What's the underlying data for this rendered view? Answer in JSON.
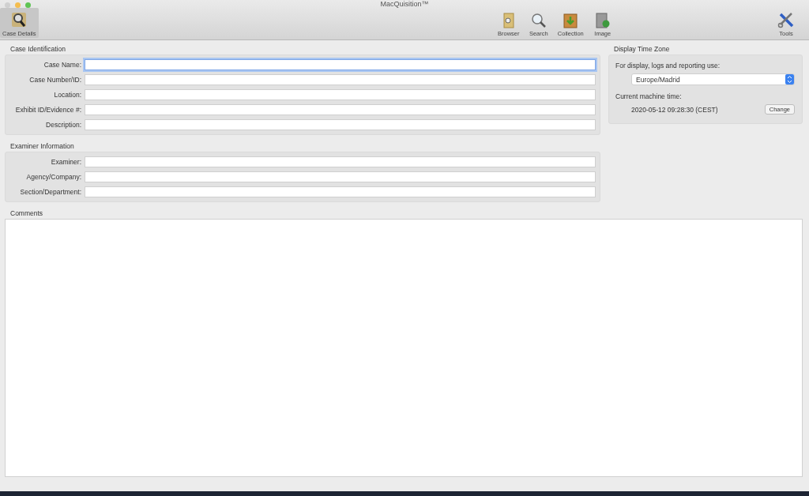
{
  "window": {
    "title": "MacQuisition™"
  },
  "toolbar": {
    "left": [
      {
        "label": "Case Details",
        "selected": true
      }
    ],
    "center": [
      {
        "label": "Browser",
        "selected": false
      },
      {
        "label": "Search",
        "selected": false
      },
      {
        "label": "Collection",
        "selected": false
      },
      {
        "label": "Image",
        "selected": false
      }
    ],
    "right": [
      {
        "label": "Tools",
        "selected": false
      }
    ]
  },
  "case_identification": {
    "title": "Case Identification",
    "fields": [
      {
        "label": "Case Name:",
        "focused": true
      },
      {
        "label": "Case Number/ID:",
        "focused": false
      },
      {
        "label": "Location:",
        "focused": false
      },
      {
        "label": "Exhibit ID/Evidence #:",
        "focused": false
      },
      {
        "label": "Description:",
        "focused": false
      }
    ]
  },
  "examiner_information": {
    "title": "Examiner Information",
    "fields": [
      {
        "label": "Examiner:",
        "focused": false
      },
      {
        "label": "Agency/Company:",
        "focused": false
      },
      {
        "label": "Section/Department:",
        "focused": false
      }
    ]
  },
  "comments": {
    "title": "Comments"
  },
  "time_zone": {
    "title": "Display Time Zone",
    "prompt": "For display, logs and reporting use:",
    "value": "Europe/Madrid",
    "machine_time_label": "Current machine time:",
    "machine_time": "2020-05-12 09:28:30 (CEST)",
    "change_button": "Change"
  }
}
